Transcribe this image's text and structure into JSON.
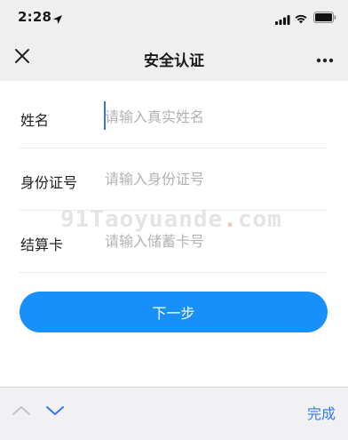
{
  "status_bar": {
    "time": "2:28",
    "icons": [
      "location-arrow-icon",
      "cellular-signal-icon",
      "wifi-icon",
      "battery-icon"
    ]
  },
  "nav": {
    "title": "安全认证",
    "close_icon": "close-icon",
    "more_icon": "more-icon"
  },
  "form": {
    "name": {
      "label": "姓名",
      "placeholder": "请输入真实姓名",
      "value": ""
    },
    "id_number": {
      "label": "身份证号",
      "placeholder": "请输入身份证号",
      "value": ""
    },
    "card": {
      "label": "结算卡",
      "placeholder": "请输入储蓄卡号",
      "value": ""
    }
  },
  "watermark": {
    "prefix": "91Taoyuande",
    "dot": ".",
    "suffix": "com"
  },
  "next_button": {
    "label": "下一步"
  },
  "accessory_bar": {
    "prev_icon": "chevron-up-icon",
    "next_icon": "chevron-down-icon",
    "done_label": "完成"
  },
  "colors": {
    "primary_button": "#1890fa",
    "done_text": "#3478f6",
    "cursor": "#3b6df0",
    "header_bg": "#efefef"
  }
}
